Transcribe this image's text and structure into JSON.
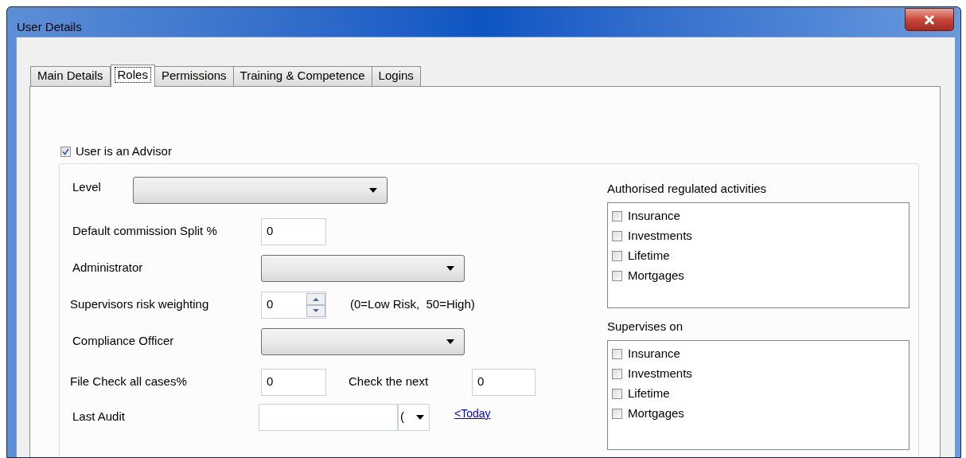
{
  "window": {
    "title": "User Details"
  },
  "tabs": [
    {
      "label": "Main Details",
      "selected": false
    },
    {
      "label": "Roles",
      "selected": true
    },
    {
      "label": "Permissions",
      "selected": false
    },
    {
      "label": "Training & Competence",
      "selected": false
    },
    {
      "label": "Logins",
      "selected": false
    }
  ],
  "advisor": {
    "label": "User is an Advisor",
    "checked": true
  },
  "level": {
    "label": "Level"
  },
  "default_commission_split": {
    "label": "Default commission Split %",
    "value": "0"
  },
  "administrator": {
    "label": "Administrator"
  },
  "supervisors_risk_weighting": {
    "label": "Supervisors risk weighting",
    "value": "0",
    "hint": "(0=Low Risk,  50=High)"
  },
  "compliance_officer": {
    "label": "Compliance Officer"
  },
  "file_check_all_cases": {
    "label": "File Check all cases%",
    "value": "0"
  },
  "check_the_next": {
    "label": "Check the next",
    "value": "0"
  },
  "last_audit": {
    "label": "Last Audit",
    "date_part": "(",
    "link": "<Today"
  },
  "lists": [
    {
      "label": "Authorised regulated activities",
      "items": [
        {
          "label": "Insurance",
          "checked": false
        },
        {
          "label": "Investments",
          "checked": false
        },
        {
          "label": "Lifetime",
          "checked": false
        },
        {
          "label": "Mortgages",
          "checked": false
        }
      ]
    },
    {
      "label": "Supervises on",
      "items": [
        {
          "label": "Insurance",
          "checked": false
        },
        {
          "label": "Investments",
          "checked": false
        },
        {
          "label": "Lifetime",
          "checked": false
        },
        {
          "label": "Mortgages",
          "checked": false
        }
      ]
    }
  ]
}
